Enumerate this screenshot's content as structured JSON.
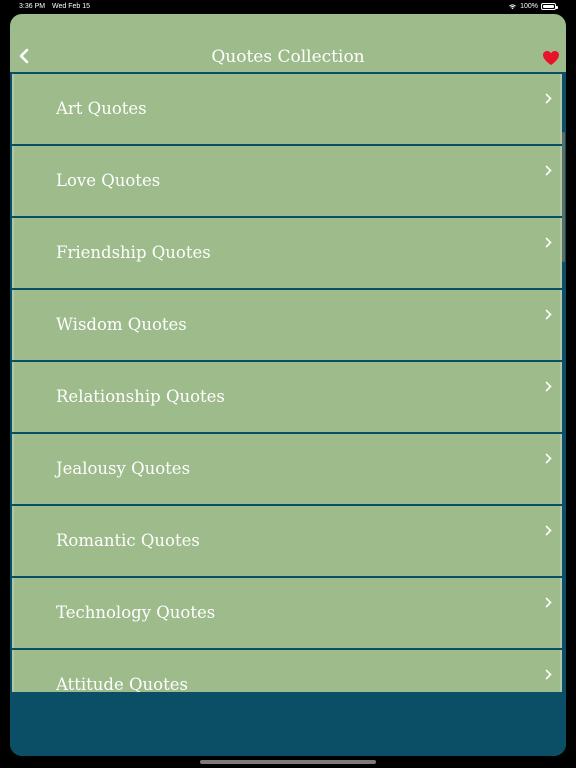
{
  "status_bar": {
    "time": "3:36 PM",
    "date": "Wed Feb 15",
    "battery": "100%",
    "icons": [
      "wifi-icon",
      "battery-icon"
    ]
  },
  "nav": {
    "title": "Quotes Collection",
    "back_icon": "chevron-left-icon",
    "favorite_icon": "heart-icon"
  },
  "colors": {
    "item_background": "#9dbb8b",
    "separator": "#0b4f66",
    "heart": "#e8132b",
    "text": "#ffffff"
  },
  "categories": [
    {
      "label": "Art Quotes"
    },
    {
      "label": "Love Quotes"
    },
    {
      "label": "Friendship Quotes"
    },
    {
      "label": "Wisdom Quotes"
    },
    {
      "label": "Relationship Quotes"
    },
    {
      "label": "Jealousy Quotes"
    },
    {
      "label": "Romantic Quotes"
    },
    {
      "label": "Technology Quotes"
    },
    {
      "label": "Attitude Quotes"
    }
  ]
}
